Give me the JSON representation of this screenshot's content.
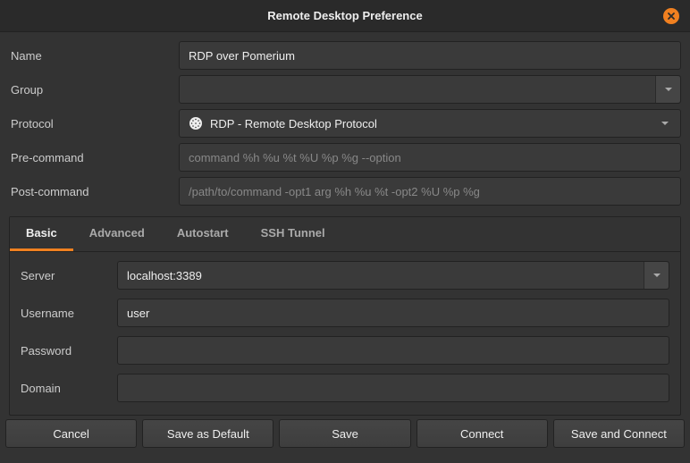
{
  "title": "Remote Desktop Preference",
  "fields": {
    "name": {
      "label": "Name",
      "value": "RDP over Pomerium"
    },
    "group": {
      "label": "Group",
      "value": ""
    },
    "protocol": {
      "label": "Protocol",
      "value": "RDP - Remote Desktop Protocol"
    },
    "pre_command": {
      "label": "Pre-command",
      "placeholder": "command %h %u %t %U %p %g --option",
      "value": ""
    },
    "post_command": {
      "label": "Post-command",
      "placeholder": "/path/to/command -opt1 arg %h %u %t -opt2 %U %p %g",
      "value": ""
    }
  },
  "tabs": [
    {
      "label": "Basic"
    },
    {
      "label": "Advanced"
    },
    {
      "label": "Autostart"
    },
    {
      "label": "SSH Tunnel"
    }
  ],
  "basic": {
    "server": {
      "label": "Server",
      "value": "localhost:3389"
    },
    "username": {
      "label": "Username",
      "value": "user"
    },
    "password": {
      "label": "Password",
      "value": ""
    },
    "domain": {
      "label": "Domain",
      "value": ""
    }
  },
  "buttons": {
    "cancel": "Cancel",
    "save_default": "Save as Default",
    "save": "Save",
    "connect": "Connect",
    "save_connect": "Save and Connect"
  }
}
